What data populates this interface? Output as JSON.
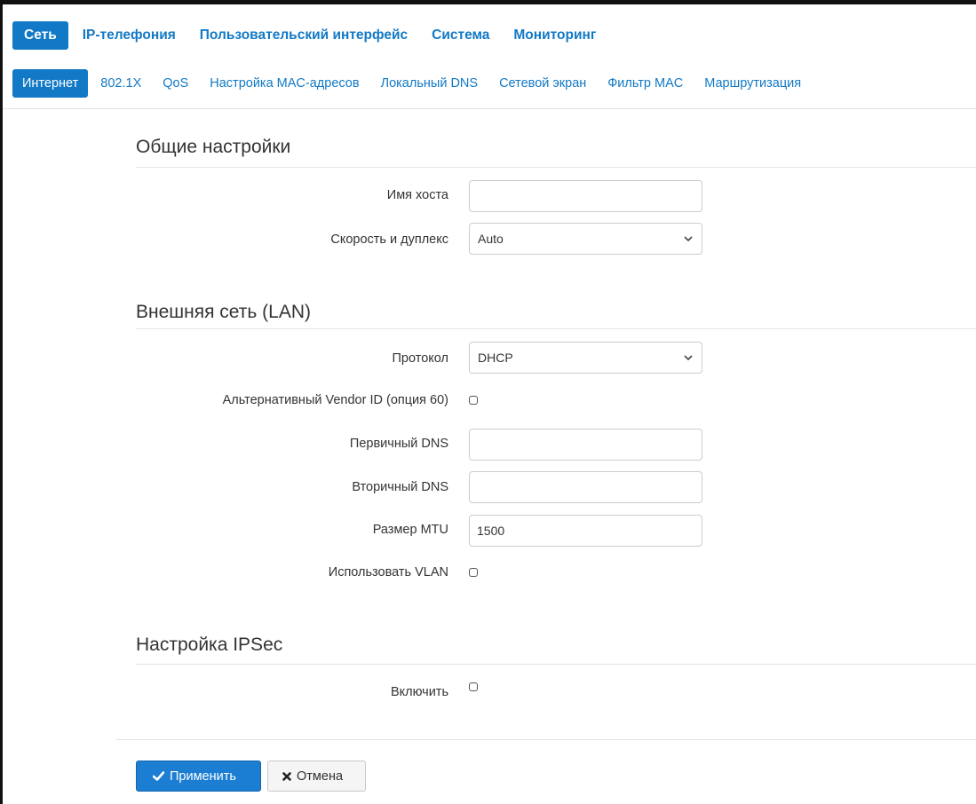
{
  "main_nav": [
    "Сеть",
    "IP-телефония",
    "Пользовательский интерфейс",
    "Система",
    "Мониторинг"
  ],
  "sub_nav": [
    "Интернет",
    "802.1X",
    "QoS",
    "Настройка MAC-адресов",
    "Локальный DNS",
    "Сетевой экран",
    "Фильтр MAC",
    "Маршрутизация"
  ],
  "sections": {
    "general": {
      "title": "Общие настройки",
      "hostname_label": "Имя хоста",
      "hostname_value": "",
      "speed_label": "Скорость и дуплекс",
      "speed_value": "Auto"
    },
    "wan": {
      "title": "Внешняя сеть (LAN)",
      "protocol_label": "Протокол",
      "protocol_value": "DHCP",
      "vendor_id_label": "Альтернативный Vendor ID (опция 60)",
      "vendor_id_checked": false,
      "dns1_label": "Первичный DNS",
      "dns1_value": "",
      "dns2_label": "Вторичный DNS",
      "dns2_value": "",
      "mtu_label": "Размер MTU",
      "mtu_value": "1500",
      "vlan_label": "Использовать VLAN",
      "vlan_checked": false
    },
    "ipsec": {
      "title": "Настройка IPSec",
      "enable_label": "Включить",
      "enable_checked": false
    }
  },
  "buttons": {
    "apply": "Применить",
    "cancel": "Отмена"
  },
  "colors": {
    "accent": "#1279c6",
    "apply_button": "#1b7ed3"
  },
  "icons": {
    "apply": "check-icon",
    "cancel": "close-icon",
    "select": "chevron-down-icon"
  }
}
